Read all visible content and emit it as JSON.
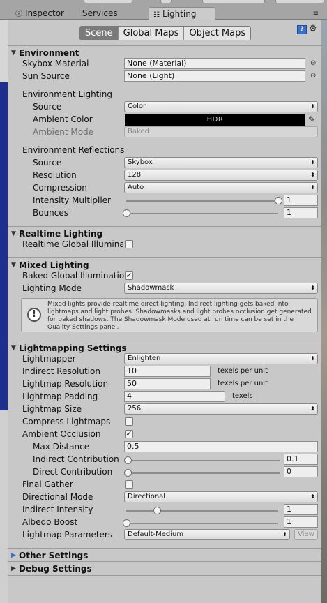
{
  "tabs": [
    {
      "label": "Inspector",
      "icon": "info-icon"
    },
    {
      "label": "Services"
    },
    {
      "label": "Lighting",
      "icon": "lighting-icon"
    }
  ],
  "toolbar": {
    "segments": [
      "Scene",
      "Global Maps",
      "Object Maps"
    ],
    "selected": "Scene"
  },
  "environment": {
    "title": "Environment",
    "skybox_material_label": "Skybox Material",
    "skybox_material_value": "None (Material)",
    "sun_source_label": "Sun Source",
    "sun_source_value": "None (Light)",
    "env_lighting_label": "Environment Lighting",
    "source_label": "Source",
    "source_value": "Color",
    "ambient_color_label": "Ambient Color",
    "ambient_color_value": "HDR",
    "ambient_mode_label": "Ambient Mode",
    "ambient_mode_value": "Baked",
    "env_reflections_label": "Environment Reflections",
    "refl_source_label": "Source",
    "refl_source_value": "Skybox",
    "resolution_label": "Resolution",
    "resolution_value": "128",
    "compression_label": "Compression",
    "compression_value": "Auto",
    "intensity_label": "Intensity Multiplier",
    "intensity_value": "1",
    "intensity_slider": 1.0,
    "bounces_label": "Bounces",
    "bounces_value": "1",
    "bounces_slider": 0.0
  },
  "realtime": {
    "title": "Realtime Lighting",
    "gi_label": "Realtime Global Illuminat",
    "gi_checked": false
  },
  "mixed": {
    "title": "Mixed Lighting",
    "baked_gi_label": "Baked Global Illuminatior",
    "baked_gi_checked": true,
    "mode_label": "Lighting Mode",
    "mode_value": "Shadowmask",
    "help_text": "Mixed lights provide realtime direct lighting. Indirect lighting gets baked into lightmaps and light probes. Shadowmasks and light probes occlusion get generated for baked shadows. The Shadowmask Mode used at run time can be set in the Quality Settings panel."
  },
  "lightmapping": {
    "title": "Lightmapping Settings",
    "lightmapper_label": "Lightmapper",
    "lightmapper_value": "Enlighten",
    "indirect_res_label": "Indirect Resolution",
    "indirect_res_value": "10",
    "indirect_res_unit": "texels per unit",
    "lightmap_res_label": "Lightmap Resolution",
    "lightmap_res_value": "50",
    "lightmap_res_unit": "texels per unit",
    "padding_label": "Lightmap Padding",
    "padding_value": "4",
    "padding_unit": "texels",
    "size_label": "Lightmap Size",
    "size_value": "256",
    "compress_label": "Compress Lightmaps",
    "compress_checked": false,
    "ao_label": "Ambient Occlusion",
    "ao_checked": true,
    "max_distance_label": "Max Distance",
    "max_distance_value": "0.5",
    "indirect_contrib_label": "Indirect Contribution",
    "indirect_contrib_value": "0.1",
    "indirect_contrib_slider": 0.0,
    "direct_contrib_label": "Direct Contribution",
    "direct_contrib_value": "0",
    "direct_contrib_slider": 0.0,
    "final_gather_label": "Final Gather",
    "final_gather_checked": false,
    "directional_mode_label": "Directional Mode",
    "directional_mode_value": "Directional",
    "indirect_intensity_label": "Indirect Intensity",
    "indirect_intensity_value": "1",
    "indirect_intensity_slider": 0.2,
    "albedo_boost_label": "Albedo Boost",
    "albedo_boost_value": "1",
    "albedo_boost_slider": 0.0,
    "params_label": "Lightmap Parameters",
    "params_value": "Default-Medium",
    "view_label": "View"
  },
  "other": {
    "title": "Other Settings"
  },
  "debug": {
    "title": "Debug Settings"
  },
  "symbols": {
    "down_triangle": "▼",
    "right_triangle": "▶",
    "dropdown_arrow": "⬍",
    "picker": "⊙",
    "check": "✓",
    "warning": "!",
    "help": "?",
    "gear": "⚙",
    "eyedropper": "✎",
    "menu": "≡"
  }
}
